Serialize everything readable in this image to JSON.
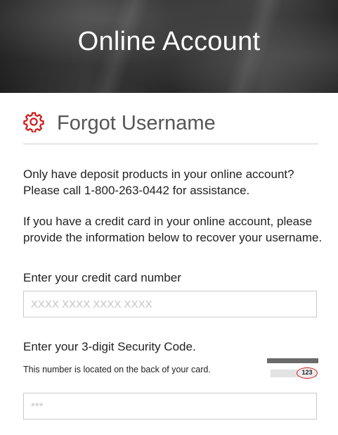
{
  "hero": {
    "title": "Online Account"
  },
  "section": {
    "icon": "gear-icon",
    "title": "Forgot Username",
    "accent_color": "#d11a1a"
  },
  "info": {
    "deposit_notice": "Only have deposit products in your online account? Please call 1-800-263-0442 for assistance.",
    "credit_notice": "If you have a credit card in your online account, please provide the information below to recover your username."
  },
  "form": {
    "card_number": {
      "label": "Enter your credit card number",
      "placeholder": "XXXX XXXX XXXX XXXX",
      "value": ""
    },
    "security_code": {
      "label": "Enter your 3-digit Security Code.",
      "hint": "This number is located on the back of your card.",
      "sample_code": "123",
      "placeholder": "***",
      "value": ""
    }
  }
}
